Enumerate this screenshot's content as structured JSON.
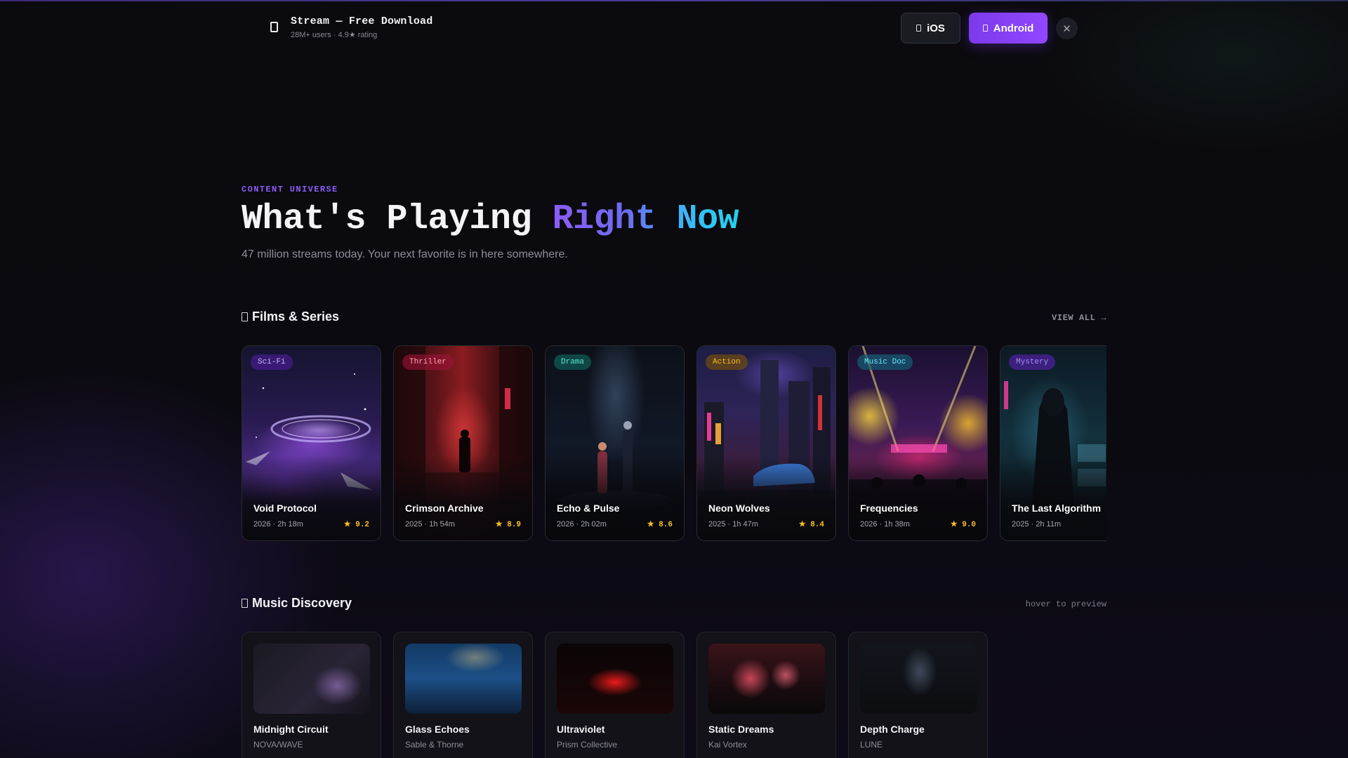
{
  "banner": {
    "title": "Stream — Free Download",
    "subtitle": "28M+ users · 4.9★ rating",
    "ios_label": "iOS",
    "android_label": "Android",
    "close_label": "✕"
  },
  "hero": {
    "eyebrow": "CONTENT UNIVERSE",
    "title_main": "What's Playing ",
    "title_accent": "Right Now",
    "subtitle": "47 million streams today. Your next favorite is in here somewhere."
  },
  "films": {
    "title": "Films & Series",
    "view_all": "VIEW ALL →",
    "items": [
      {
        "title": "Void Protocol",
        "meta": "2026 · 2h 18m",
        "rating": "★ 9.2",
        "genre": "Sci-Fi"
      },
      {
        "title": "Crimson Archive",
        "meta": "2025 · 1h 54m",
        "rating": "★ 8.9",
        "genre": "Thriller"
      },
      {
        "title": "Echo & Pulse",
        "meta": "2026 · 2h 02m",
        "rating": "★ 8.6",
        "genre": "Drama"
      },
      {
        "title": "Neon Wolves",
        "meta": "2025 · 1h 47m",
        "rating": "★ 8.4",
        "genre": "Action"
      },
      {
        "title": "Frequencies",
        "meta": "2026 · 1h 38m",
        "rating": "★ 9.0",
        "genre": "Music Doc"
      },
      {
        "title": "The Last Algorithm",
        "meta": "2025 · 2h 11m",
        "rating": "★",
        "genre": "Mystery"
      }
    ]
  },
  "music": {
    "title": "Music Discovery",
    "hint": "hover to preview",
    "items": [
      {
        "title": "Midnight Circuit",
        "artist": "NOVA/WAVE"
      },
      {
        "title": "Glass Echoes",
        "artist": "Sable & Thorne"
      },
      {
        "title": "Ultraviolet",
        "artist": "Prism Collective"
      },
      {
        "title": "Static Dreams",
        "artist": "Kai Vortex"
      },
      {
        "title": "Depth Charge",
        "artist": "LUNE"
      }
    ]
  },
  "colors": {
    "accent": "#7c3aed",
    "accent_gradient_end": "#22d3ee",
    "rating": "#fbbf24",
    "genre_sci_fi": "#8b5cf6",
    "genre_thriller": "#f43f5e",
    "genre_drama": "#2dd4bf",
    "genre_action": "#f59e0b",
    "genre_music_doc": "#22d3ee",
    "genre_mystery": "#a78bfa"
  }
}
